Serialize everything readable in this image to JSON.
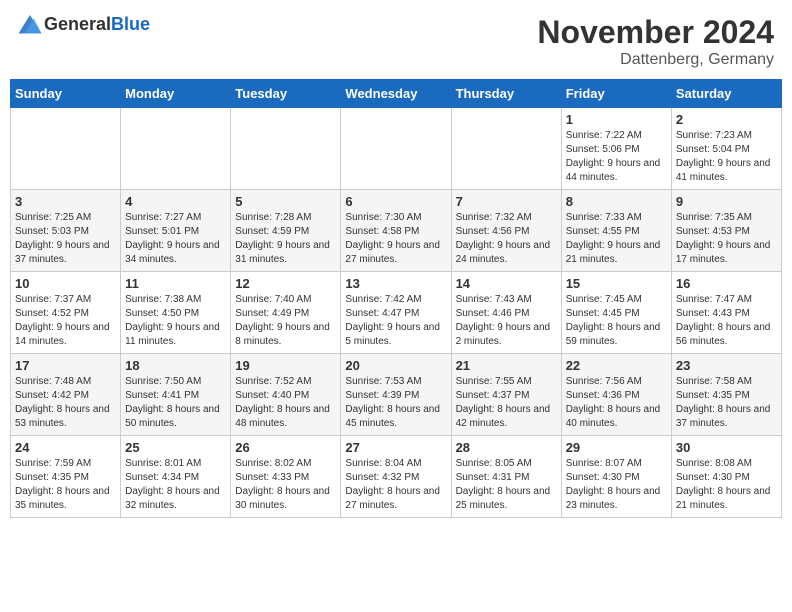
{
  "header": {
    "logo_general": "General",
    "logo_blue": "Blue",
    "month": "November 2024",
    "location": "Dattenberg, Germany"
  },
  "days_of_week": [
    "Sunday",
    "Monday",
    "Tuesday",
    "Wednesday",
    "Thursday",
    "Friday",
    "Saturday"
  ],
  "weeks": [
    [
      {
        "day": "",
        "info": ""
      },
      {
        "day": "",
        "info": ""
      },
      {
        "day": "",
        "info": ""
      },
      {
        "day": "",
        "info": ""
      },
      {
        "day": "",
        "info": ""
      },
      {
        "day": "1",
        "info": "Sunrise: 7:22 AM\nSunset: 5:06 PM\nDaylight: 9 hours and 44 minutes."
      },
      {
        "day": "2",
        "info": "Sunrise: 7:23 AM\nSunset: 5:04 PM\nDaylight: 9 hours and 41 minutes."
      }
    ],
    [
      {
        "day": "3",
        "info": "Sunrise: 7:25 AM\nSunset: 5:03 PM\nDaylight: 9 hours and 37 minutes."
      },
      {
        "day": "4",
        "info": "Sunrise: 7:27 AM\nSunset: 5:01 PM\nDaylight: 9 hours and 34 minutes."
      },
      {
        "day": "5",
        "info": "Sunrise: 7:28 AM\nSunset: 4:59 PM\nDaylight: 9 hours and 31 minutes."
      },
      {
        "day": "6",
        "info": "Sunrise: 7:30 AM\nSunset: 4:58 PM\nDaylight: 9 hours and 27 minutes."
      },
      {
        "day": "7",
        "info": "Sunrise: 7:32 AM\nSunset: 4:56 PM\nDaylight: 9 hours and 24 minutes."
      },
      {
        "day": "8",
        "info": "Sunrise: 7:33 AM\nSunset: 4:55 PM\nDaylight: 9 hours and 21 minutes."
      },
      {
        "day": "9",
        "info": "Sunrise: 7:35 AM\nSunset: 4:53 PM\nDaylight: 9 hours and 17 minutes."
      }
    ],
    [
      {
        "day": "10",
        "info": "Sunrise: 7:37 AM\nSunset: 4:52 PM\nDaylight: 9 hours and 14 minutes."
      },
      {
        "day": "11",
        "info": "Sunrise: 7:38 AM\nSunset: 4:50 PM\nDaylight: 9 hours and 11 minutes."
      },
      {
        "day": "12",
        "info": "Sunrise: 7:40 AM\nSunset: 4:49 PM\nDaylight: 9 hours and 8 minutes."
      },
      {
        "day": "13",
        "info": "Sunrise: 7:42 AM\nSunset: 4:47 PM\nDaylight: 9 hours and 5 minutes."
      },
      {
        "day": "14",
        "info": "Sunrise: 7:43 AM\nSunset: 4:46 PM\nDaylight: 9 hours and 2 minutes."
      },
      {
        "day": "15",
        "info": "Sunrise: 7:45 AM\nSunset: 4:45 PM\nDaylight: 8 hours and 59 minutes."
      },
      {
        "day": "16",
        "info": "Sunrise: 7:47 AM\nSunset: 4:43 PM\nDaylight: 8 hours and 56 minutes."
      }
    ],
    [
      {
        "day": "17",
        "info": "Sunrise: 7:48 AM\nSunset: 4:42 PM\nDaylight: 8 hours and 53 minutes."
      },
      {
        "day": "18",
        "info": "Sunrise: 7:50 AM\nSunset: 4:41 PM\nDaylight: 8 hours and 50 minutes."
      },
      {
        "day": "19",
        "info": "Sunrise: 7:52 AM\nSunset: 4:40 PM\nDaylight: 8 hours and 48 minutes."
      },
      {
        "day": "20",
        "info": "Sunrise: 7:53 AM\nSunset: 4:39 PM\nDaylight: 8 hours and 45 minutes."
      },
      {
        "day": "21",
        "info": "Sunrise: 7:55 AM\nSunset: 4:37 PM\nDaylight: 8 hours and 42 minutes."
      },
      {
        "day": "22",
        "info": "Sunrise: 7:56 AM\nSunset: 4:36 PM\nDaylight: 8 hours and 40 minutes."
      },
      {
        "day": "23",
        "info": "Sunrise: 7:58 AM\nSunset: 4:35 PM\nDaylight: 8 hours and 37 minutes."
      }
    ],
    [
      {
        "day": "24",
        "info": "Sunrise: 7:59 AM\nSunset: 4:35 PM\nDaylight: 8 hours and 35 minutes."
      },
      {
        "day": "25",
        "info": "Sunrise: 8:01 AM\nSunset: 4:34 PM\nDaylight: 8 hours and 32 minutes."
      },
      {
        "day": "26",
        "info": "Sunrise: 8:02 AM\nSunset: 4:33 PM\nDaylight: 8 hours and 30 minutes."
      },
      {
        "day": "27",
        "info": "Sunrise: 8:04 AM\nSunset: 4:32 PM\nDaylight: 8 hours and 27 minutes."
      },
      {
        "day": "28",
        "info": "Sunrise: 8:05 AM\nSunset: 4:31 PM\nDaylight: 8 hours and 25 minutes."
      },
      {
        "day": "29",
        "info": "Sunrise: 8:07 AM\nSunset: 4:30 PM\nDaylight: 8 hours and 23 minutes."
      },
      {
        "day": "30",
        "info": "Sunrise: 8:08 AM\nSunset: 4:30 PM\nDaylight: 8 hours and 21 minutes."
      }
    ]
  ]
}
